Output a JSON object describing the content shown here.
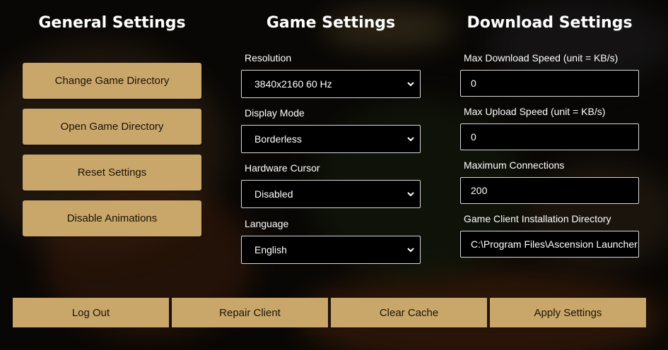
{
  "columns": {
    "general_title": "General Settings",
    "game_title": "Game Settings",
    "download_title": "Download Settings"
  },
  "general": {
    "change_dir_label": "Change Game Directory",
    "open_dir_label": "Open Game Directory",
    "reset_label": "Reset Settings",
    "disable_anim_label": "Disable Animations"
  },
  "game": {
    "resolution_label": "Resolution",
    "resolution_value": "3840x2160 60 Hz",
    "display_mode_label": "Display Mode",
    "display_mode_value": "Borderless",
    "hardware_cursor_label": "Hardware Cursor",
    "hardware_cursor_value": "Disabled",
    "language_label": "Language",
    "language_value": "English"
  },
  "download": {
    "max_download_label": "Max Download Speed (unit = KB/s)",
    "max_download_value": "0",
    "max_upload_label": "Max Upload Speed (unit = KB/s)",
    "max_upload_value": "0",
    "max_connections_label": "Maximum Connections",
    "max_connections_value": "200",
    "install_dir_label": "Game Client Installation Directory",
    "install_dir_value": "C:\\Program Files\\Ascension Launcher"
  },
  "footer": {
    "logout_label": "Log Out",
    "repair_label": "Repair Client",
    "clear_cache_label": "Clear Cache",
    "apply_label": "Apply Settings"
  },
  "colors": {
    "button_bg": "#c9a76a",
    "button_text": "#1b1306",
    "input_bg": "#000000",
    "input_border": "#d8d8d8"
  },
  "icons": {
    "select_chevron": "chevron-down-icon"
  }
}
